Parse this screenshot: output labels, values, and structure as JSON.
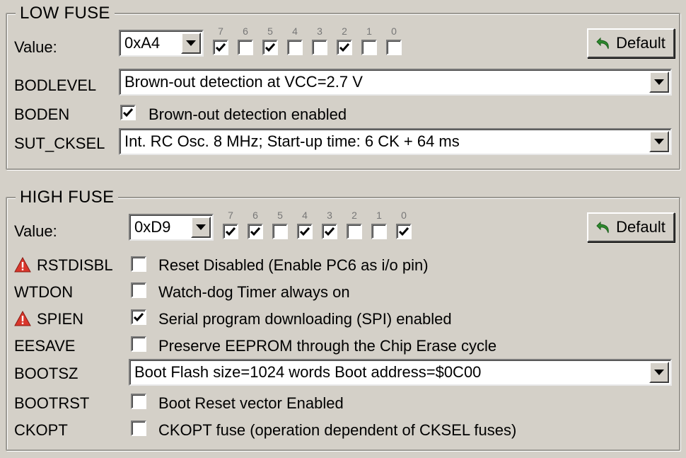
{
  "low_fuse": {
    "title": "LOW FUSE",
    "value_label": "Value:",
    "value": "0xA4",
    "bit_labels": [
      "7",
      "6",
      "5",
      "4",
      "3",
      "2",
      "1",
      "0"
    ],
    "bits_checked": [
      true,
      false,
      true,
      false,
      false,
      true,
      false,
      false
    ],
    "default_label": "Default",
    "bodlevel": {
      "label": "BODLEVEL",
      "value": "Brown-out detection at VCC=2.7 V"
    },
    "boden": {
      "label": "BODEN",
      "text": "Brown-out detection enabled",
      "checked": true
    },
    "sut_cksel": {
      "label": "SUT_CKSEL",
      "value": "Int. RC Osc. 8 MHz; Start-up time: 6 CK + 64 ms"
    }
  },
  "high_fuse": {
    "title": "HIGH FUSE",
    "value_label": "Value:",
    "value": "0xD9",
    "bit_labels": [
      "7",
      "6",
      "5",
      "4",
      "3",
      "2",
      "1",
      "0"
    ],
    "bits_checked": [
      true,
      true,
      false,
      true,
      true,
      false,
      false,
      true
    ],
    "default_label": "Default",
    "rstdisbl": {
      "label": "RSTDISBL",
      "text": "Reset Disabled (Enable PC6 as i/o pin)",
      "checked": false,
      "warning": true
    },
    "wtdon": {
      "label": "WTDON",
      "text": "Watch-dog Timer always on",
      "checked": false
    },
    "spien": {
      "label": "SPIEN",
      "text": "Serial program downloading (SPI) enabled",
      "checked": true,
      "warning": true
    },
    "eesave": {
      "label": "EESAVE",
      "text": "Preserve EEPROM through the Chip Erase cycle",
      "checked": false
    },
    "bootsz": {
      "label": "BOOTSZ",
      "value": "Boot Flash size=1024 words Boot address=$0C00"
    },
    "bootrst": {
      "label": "BOOTRST",
      "text": "Boot Reset vector Enabled",
      "checked": false
    },
    "ckopt": {
      "label": "CKOPT",
      "text": "CKOPT fuse (operation dependent of CKSEL fuses)",
      "checked": false
    }
  },
  "icons": {
    "default": "undo-arrow-icon",
    "warning": "warning-triangle-icon",
    "dropdown": "chevron-down-icon",
    "check": "check-icon"
  },
  "colors": {
    "background": "#d4d0c8",
    "warning_red": "#d9362b",
    "undo_green": "#2e8b2e"
  }
}
